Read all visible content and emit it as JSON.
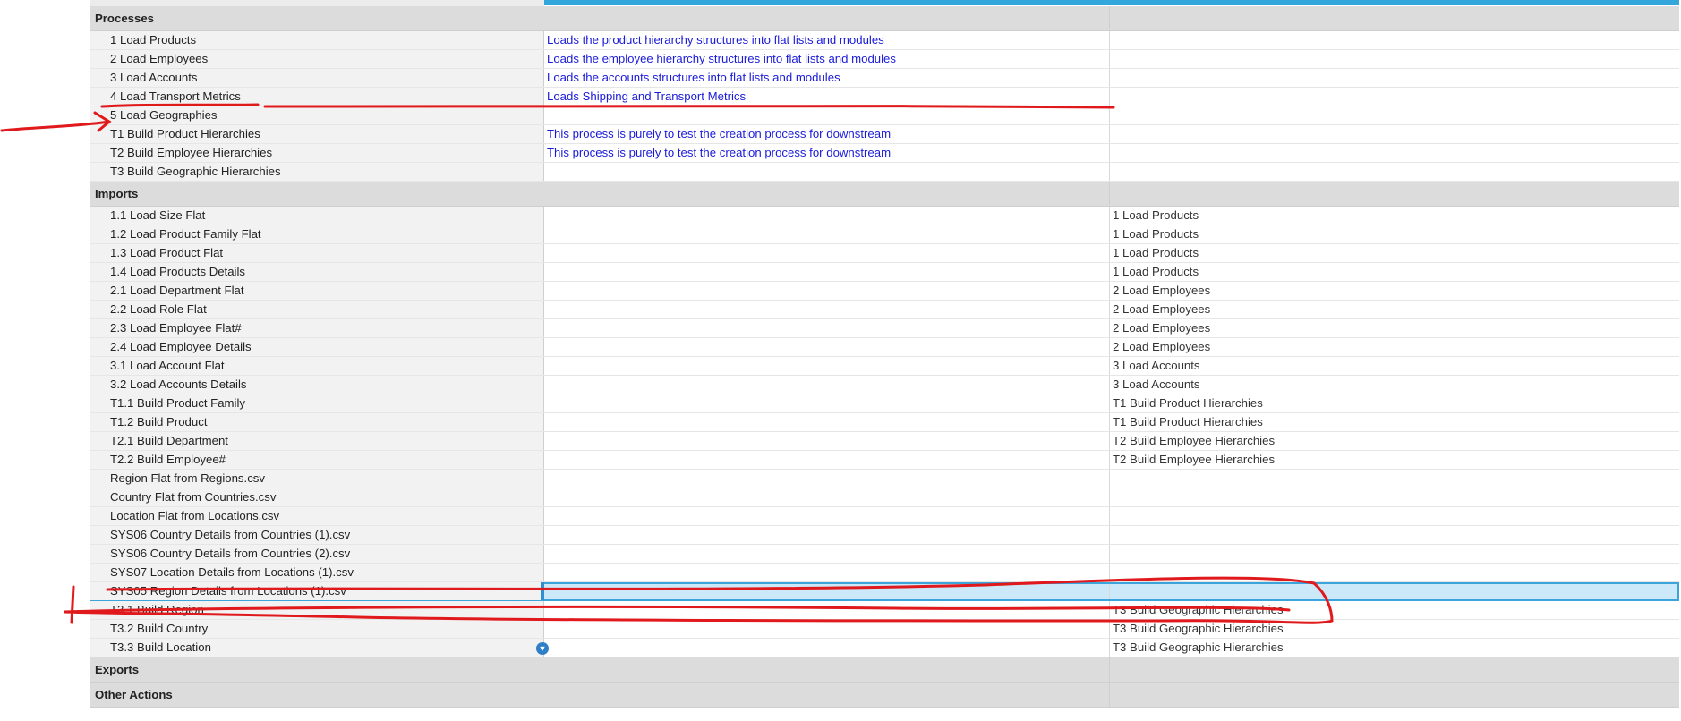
{
  "sections": {
    "processes": {
      "label": "Processes",
      "rows": [
        {
          "name": "1 Load Products",
          "desc": "Loads the product hierarchy structures into flat lists and modules",
          "parent": ""
        },
        {
          "name": "2 Load Employees",
          "desc": "Loads the employee hierarchy structures into flat lists and modules",
          "parent": ""
        },
        {
          "name": "3 Load Accounts",
          "desc": "Loads the accounts structures into flat lists and modules",
          "parent": ""
        },
        {
          "name": "4 Load Transport Metrics",
          "desc": "Loads Shipping and Transport Metrics",
          "parent": ""
        },
        {
          "name": "5 Load Geographies",
          "desc": "",
          "parent": ""
        },
        {
          "name": "T1 Build Product Hierarchies",
          "desc": "This process is purely to test the creation process for downstream",
          "parent": ""
        },
        {
          "name": "T2 Build Employee Hierarchies",
          "desc": "This process is purely to test the creation process for downstream",
          "parent": ""
        },
        {
          "name": "T3 Build Geographic Hierarchies",
          "desc": "",
          "parent": ""
        }
      ]
    },
    "imports": {
      "label": "Imports",
      "rows": [
        {
          "name": "1.1 Load Size Flat",
          "desc": "",
          "parent": "1 Load Products"
        },
        {
          "name": "1.2 Load Product Family Flat",
          "desc": "",
          "parent": "1 Load Products"
        },
        {
          "name": "1.3 Load Product Flat",
          "desc": "",
          "parent": "1 Load Products"
        },
        {
          "name": "1.4 Load Products Details",
          "desc": "",
          "parent": "1 Load Products"
        },
        {
          "name": "2.1 Load Department Flat",
          "desc": "",
          "parent": "2 Load Employees"
        },
        {
          "name": "2.2 Load Role Flat",
          "desc": "",
          "parent": "2 Load Employees"
        },
        {
          "name": "2.3 Load Employee Flat#",
          "desc": "",
          "parent": "2 Load Employees"
        },
        {
          "name": "2.4 Load Employee Details",
          "desc": "",
          "parent": "2 Load Employees"
        },
        {
          "name": "3.1 Load Account Flat",
          "desc": "",
          "parent": "3 Load Accounts"
        },
        {
          "name": "3.2 Load Accounts Details",
          "desc": "",
          "parent": "3 Load Accounts"
        },
        {
          "name": "T1.1 Build Product Family",
          "desc": "",
          "parent": "T1 Build Product Hierarchies"
        },
        {
          "name": "T1.2 Build Product",
          "desc": "",
          "parent": "T1 Build Product Hierarchies"
        },
        {
          "name": "T2.1 Build Department",
          "desc": "",
          "parent": "T2 Build Employee Hierarchies"
        },
        {
          "name": "T2.2 Build Employee#",
          "desc": "",
          "parent": "T2 Build Employee Hierarchies"
        },
        {
          "name": "Region Flat from Regions.csv",
          "desc": "",
          "parent": ""
        },
        {
          "name": "Country Flat from Countries.csv",
          "desc": "",
          "parent": ""
        },
        {
          "name": "Location Flat from Locations.csv",
          "desc": "",
          "parent": ""
        },
        {
          "name": "SYS06 Country Details from Countries (1).csv",
          "desc": "",
          "parent": ""
        },
        {
          "name": "SYS06 Country Details from Countries (2).csv",
          "desc": "",
          "parent": ""
        },
        {
          "name": "SYS07 Location Details from Locations (1).csv",
          "desc": "",
          "parent": ""
        },
        {
          "name": "SYS05 Region Details from Locations (1).csv",
          "desc": "",
          "parent": "",
          "selected": true
        },
        {
          "name": "T3.1 Build Region",
          "desc": "",
          "parent": "T3 Build Geographic Hierarchies"
        },
        {
          "name": "T3.2 Build Country",
          "desc": "",
          "parent": "T3 Build Geographic Hierarchies"
        },
        {
          "name": "T3.3 Build Location",
          "desc": "",
          "parent": "T3 Build Geographic Hierarchies",
          "dropdown": true
        }
      ]
    },
    "exports": {
      "label": "Exports"
    },
    "other_actions": {
      "label": "Other Actions"
    }
  },
  "icons": {
    "dropdown": "chevron-down-icon"
  },
  "colors": {
    "accent": "#33a6dc",
    "link_text": "#1a1adb",
    "selection": "#cce9f9",
    "annotation": "#e0191c"
  }
}
